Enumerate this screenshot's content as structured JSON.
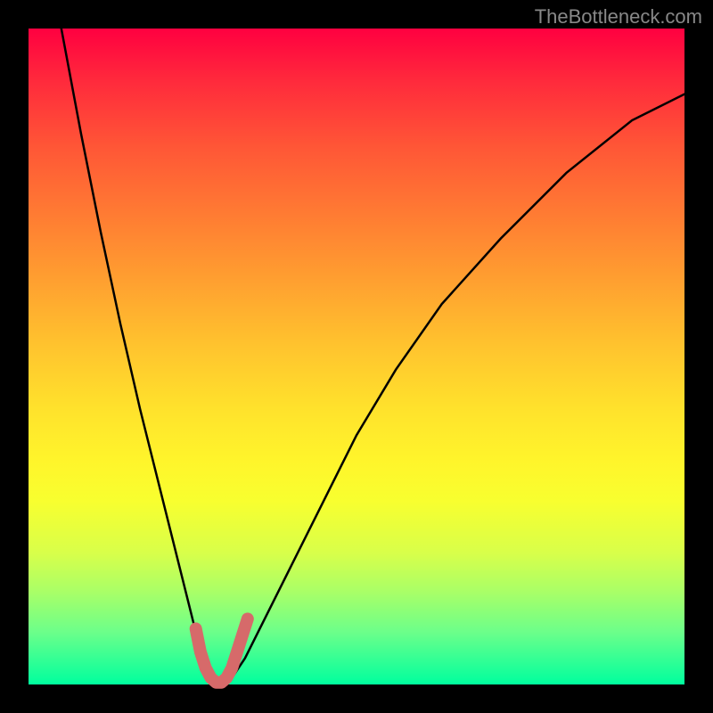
{
  "watermark": "TheBottleneck.com",
  "chart_data": {
    "type": "line",
    "title": "",
    "xlabel": "",
    "ylabel": "",
    "xlim": [
      0,
      100
    ],
    "ylim": [
      0,
      100
    ],
    "curve": {
      "x": [
        5,
        8,
        11,
        14,
        17,
        20,
        22,
        24,
        25,
        26,
        27,
        28,
        29,
        30,
        31,
        33,
        36,
        40,
        45,
        50,
        56,
        63,
        72,
        82,
        92,
        100
      ],
      "y": [
        100,
        84,
        69,
        55,
        42,
        30,
        22,
        14,
        10,
        6,
        3,
        1,
        0,
        0,
        1,
        4,
        10,
        18,
        28,
        38,
        48,
        58,
        68,
        78,
        86,
        90
      ]
    },
    "highlight_segment": {
      "x": [
        25.5,
        26.2,
        27.0,
        27.8,
        28.6,
        29.4,
        30.2,
        31.0,
        31.8,
        32.6,
        33.4
      ],
      "y": [
        8.5,
        5.0,
        2.5,
        1.0,
        0.3,
        0.3,
        1.0,
        2.5,
        5.0,
        7.5,
        10.0
      ]
    },
    "colors": {
      "curve": "#000000",
      "highlight": "#d66a6a",
      "gradient_top": "#ff0040",
      "gradient_bottom": "#00ff9e"
    }
  }
}
